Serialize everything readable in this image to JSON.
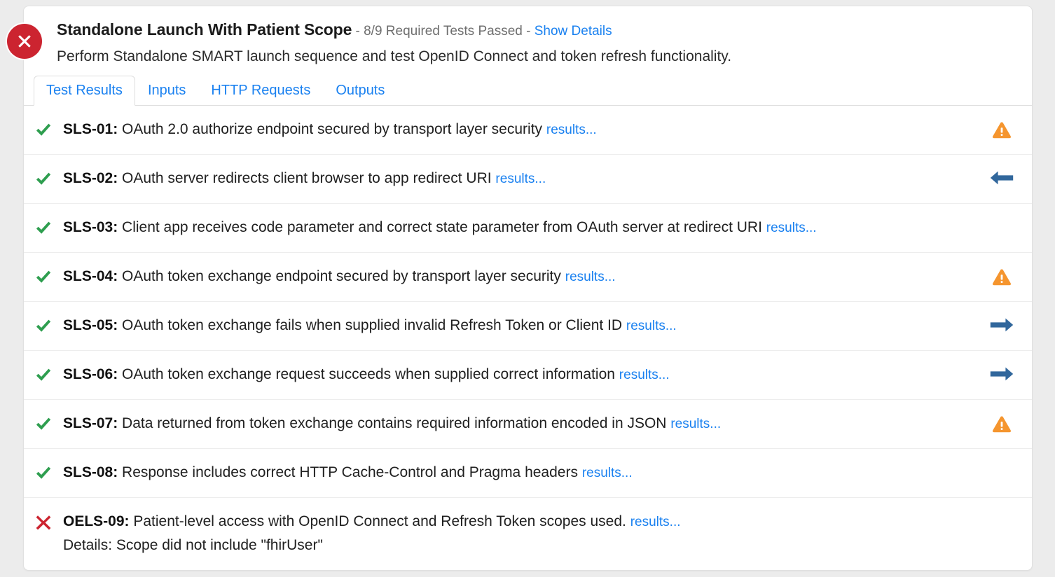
{
  "page": {
    "background_color": "#ececec",
    "card_background": "#ffffff"
  },
  "status": {
    "icon": "circle-x-fail-icon",
    "state": "fail",
    "color": "#cc2430"
  },
  "header": {
    "title": "Standalone Launch With Patient Scope",
    "separator_1": " - ",
    "summary": "8/9 Required Tests Passed",
    "separator_2": " - ",
    "show_details_label": "Show Details",
    "description": "Perform Standalone SMART launch sequence and test OpenID Connect and token refresh functionality."
  },
  "tabs": [
    {
      "label": "Test Results",
      "active": true
    },
    {
      "label": "Inputs",
      "active": false
    },
    {
      "label": "HTTP Requests",
      "active": false
    },
    {
      "label": "Outputs",
      "active": false
    }
  ],
  "colors": {
    "link": "#1a81f0",
    "pass": "#2e9e4f",
    "fail": "#cc2430",
    "warning": "#f5952e",
    "arrow": "#31679c",
    "muted_text": "#6e6e6e",
    "body_text": "#1f1f1f",
    "divider": "#ededed"
  },
  "results": [
    {
      "status_icon": "check-pass-icon",
      "status": "pass",
      "id": "SLS-01:",
      "text": "OAuth 2.0 authorize endpoint secured by transport layer security",
      "results_link_label": "results...",
      "details": "",
      "aside_icon": "warning-triangle-icon"
    },
    {
      "status_icon": "check-pass-icon",
      "status": "pass",
      "id": "SLS-02:",
      "text": "OAuth server redirects client browser to app redirect URI",
      "results_link_label": "results...",
      "details": "",
      "aside_icon": "arrow-left-icon"
    },
    {
      "status_icon": "check-pass-icon",
      "status": "pass",
      "id": "SLS-03:",
      "text": "Client app receives code parameter and correct state parameter from OAuth server at redirect URI",
      "results_link_label": "results...",
      "details": "",
      "aside_icon": "none"
    },
    {
      "status_icon": "check-pass-icon",
      "status": "pass",
      "id": "SLS-04:",
      "text": "OAuth token exchange endpoint secured by transport layer security",
      "results_link_label": "results...",
      "details": "",
      "aside_icon": "warning-triangle-icon"
    },
    {
      "status_icon": "check-pass-icon",
      "status": "pass",
      "id": "SLS-05:",
      "text": "OAuth token exchange fails when supplied invalid Refresh Token or Client ID",
      "results_link_label": "results...",
      "details": "",
      "aside_icon": "arrow-right-icon"
    },
    {
      "status_icon": "check-pass-icon",
      "status": "pass",
      "id": "SLS-06:",
      "text": "OAuth token exchange request succeeds when supplied correct information",
      "results_link_label": "results...",
      "details": "",
      "aside_icon": "arrow-right-icon"
    },
    {
      "status_icon": "check-pass-icon",
      "status": "pass",
      "id": "SLS-07:",
      "text": "Data returned from token exchange contains required information encoded in JSON",
      "results_link_label": "results...",
      "details": "",
      "aside_icon": "warning-triangle-icon"
    },
    {
      "status_icon": "check-pass-icon",
      "status": "pass",
      "id": "SLS-08:",
      "text": "Response includes correct HTTP Cache-Control and Pragma headers",
      "results_link_label": "results...",
      "details": "",
      "aside_icon": "none"
    },
    {
      "status_icon": "x-fail-icon",
      "status": "fail",
      "id": "OELS-09:",
      "text": "Patient-level access with OpenID Connect and Refresh Token scopes used.",
      "results_link_label": "results...",
      "details": "Details: Scope did not include \"fhirUser\"",
      "aside_icon": "none"
    }
  ]
}
